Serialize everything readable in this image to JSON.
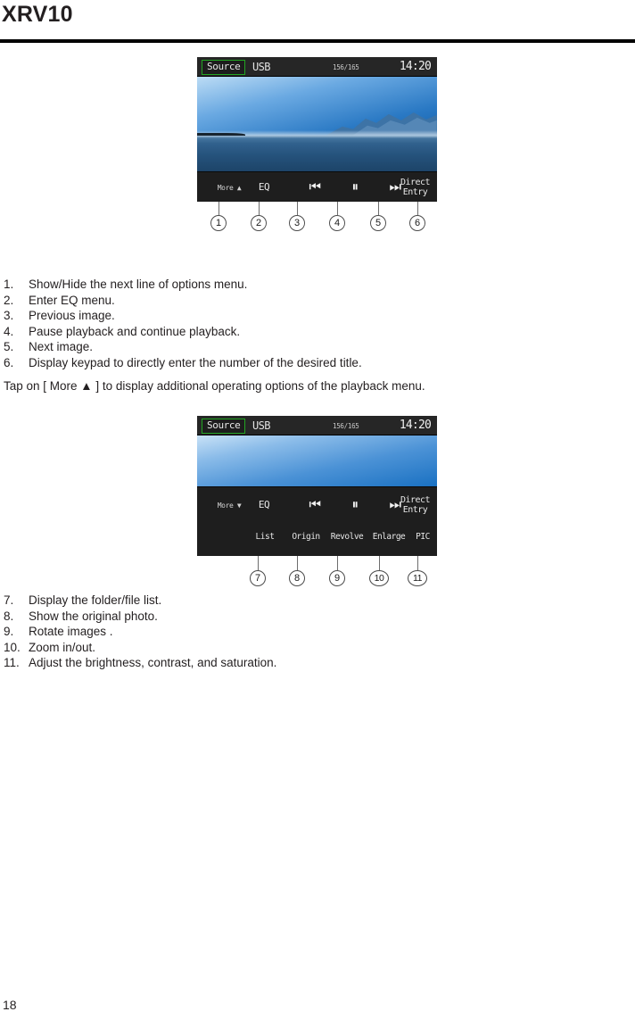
{
  "page": {
    "title": "XRV10",
    "number": "18"
  },
  "screen1": {
    "status": {
      "source_button": "Source",
      "source_label": "USB",
      "track_count": "156/165",
      "clock": "14:20"
    },
    "controls": [
      {
        "label": "More ▲",
        "icon": "more-up-icon"
      },
      {
        "label": "EQ",
        "icon": "eq-icon"
      },
      {
        "label": "⏮",
        "icon": "previous-icon"
      },
      {
        "label": "⏸",
        "icon": "pause-icon"
      },
      {
        "label": "⏭",
        "icon": "next-icon"
      },
      {
        "label": "Direct\nEntry",
        "icon": "direct-entry-icon"
      }
    ],
    "callouts": [
      "1",
      "2",
      "3",
      "4",
      "5",
      "6"
    ]
  },
  "screen2": {
    "status": {
      "source_button": "Source",
      "source_label": "USB",
      "track_count": "156/165",
      "clock": "14:20"
    },
    "controls_row1": [
      {
        "label": "More ▼",
        "icon": "more-down-icon"
      },
      {
        "label": "EQ",
        "icon": "eq-icon"
      },
      {
        "label": "⏮",
        "icon": "previous-icon"
      },
      {
        "label": "⏸",
        "icon": "pause-icon"
      },
      {
        "label": "⏭",
        "icon": "next-icon"
      },
      {
        "label": "Direct\nEntry",
        "icon": "direct-entry-icon"
      }
    ],
    "controls_row2": [
      {
        "label": "List",
        "icon": "list-icon"
      },
      {
        "label": "Origin",
        "icon": "origin-icon"
      },
      {
        "label": "Revolve",
        "icon": "revolve-icon"
      },
      {
        "label": "Enlarge",
        "icon": "enlarge-icon"
      },
      {
        "label": "PIC",
        "icon": "picture-icon"
      }
    ],
    "callouts": [
      "7",
      "8",
      "9",
      "10",
      "11"
    ]
  },
  "list1": [
    {
      "num": "1.",
      "text": "Show/Hide the next line of options menu."
    },
    {
      "num": "2.",
      "text": "Enter EQ menu."
    },
    {
      "num": "3.",
      "text": "Previous image."
    },
    {
      "num": "4.",
      "text": "Pause playback and continue playback."
    },
    {
      "num": "5.",
      "text": "Next image."
    },
    {
      "num": "6.",
      "text": "Display keypad to directly enter the number of the desired title."
    }
  ],
  "paragraph": "Tap on [ More ▲ ] to display additional operating options of the playback menu.",
  "list2": [
    {
      "num": "7.",
      "text": "Display the folder/file list."
    },
    {
      "num": "8.",
      "text": "Show the original photo."
    },
    {
      "num": "9.",
      "text": "Rotate images ."
    },
    {
      "num": "10.",
      "text": "Zoom in/out."
    },
    {
      "num": "11.",
      "text": "Adjust the brightness, contrast, and saturation."
    }
  ]
}
